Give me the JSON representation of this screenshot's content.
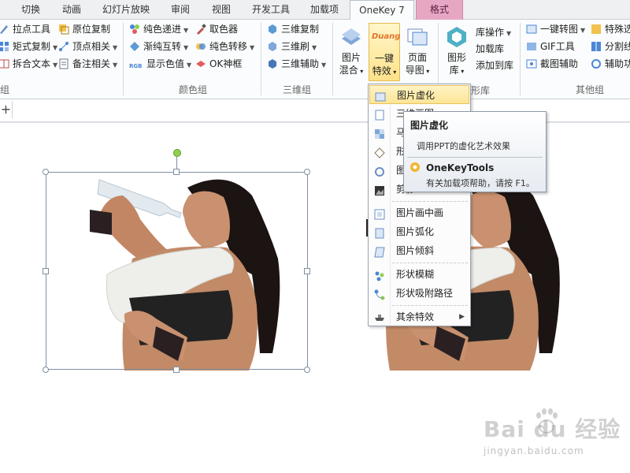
{
  "tabs": [
    {
      "label": "切换",
      "active": false
    },
    {
      "label": "动画",
      "active": false
    },
    {
      "label": "幻灯片放映",
      "active": false
    },
    {
      "label": "审阅",
      "active": false
    },
    {
      "label": "视图",
      "active": false
    },
    {
      "label": "开发工具",
      "active": false
    },
    {
      "label": "加载项",
      "active": false
    },
    {
      "label": "OneKey 7",
      "active": true
    },
    {
      "label": "格式",
      "active": false
    }
  ],
  "ribbon": {
    "group1": {
      "label": "组",
      "items": [
        {
          "label": "拉点工具",
          "icon": "pen-point-icon"
        },
        {
          "label": "矩式复制",
          "icon": "matrix-copy-icon"
        },
        {
          "label": "拆合文本",
          "icon": "split-text-icon"
        },
        {
          "label": "原位复制",
          "icon": "copy-in-place-icon"
        },
        {
          "label": "顶点相关",
          "icon": "vertex-icon"
        },
        {
          "label": "备注相关",
          "icon": "notes-icon"
        }
      ]
    },
    "color_group": {
      "label": "颜色组",
      "items": [
        {
          "label": "纯色递进",
          "icon": "color-progress-icon"
        },
        {
          "label": "渐纯互转",
          "icon": "gradient-convert-icon"
        },
        {
          "label": "显示色值",
          "icon": "rgb-value-icon",
          "prefix": "RGB"
        },
        {
          "label": "取色器",
          "icon": "eyedropper-icon"
        },
        {
          "label": "纯色转移",
          "icon": "color-transfer-icon"
        },
        {
          "label": "OK神框",
          "icon": "ok-frame-icon"
        }
      ]
    },
    "three_d_group": {
      "label": "三维组",
      "items": [
        {
          "label": "三维复制",
          "icon": "3d-copy-icon"
        },
        {
          "label": "三维刷",
          "icon": "3d-brush-icon"
        },
        {
          "label": "三维辅助",
          "icon": "3d-assist-icon"
        }
      ]
    },
    "picture_group": {
      "buttons": [
        {
          "label1": "图片",
          "label2": "混合",
          "icon": "picture-mix-icon"
        },
        {
          "label1": "一键",
          "label2": "特效",
          "icon": "duang-effects-icon",
          "icon_text": "Duang"
        },
        {
          "label1": "页面",
          "label2": "导图",
          "icon": "page-map-icon"
        },
        {
          "label1": "图形",
          "label2": "库",
          "icon": "shape-library-icon"
        }
      ],
      "label_suffix": "形库"
    },
    "library_items": [
      {
        "label": "库操作"
      },
      {
        "label": "加载库"
      },
      {
        "label": "添加到库"
      }
    ],
    "other_group": {
      "label": "其他组",
      "items": [
        {
          "label": "一键转图",
          "icon": "to-image-icon"
        },
        {
          "label": "GIF工具",
          "icon": "gif-icon"
        },
        {
          "label": "截图辅助",
          "icon": "screenshot-icon"
        },
        {
          "label": "特殊选",
          "icon": "special-select-icon"
        },
        {
          "label": "分割线",
          "icon": "divider-icon"
        },
        {
          "label": "辅助功",
          "icon": "assist-icon"
        }
      ]
    }
  },
  "menu": {
    "items": [
      {
        "label": "图片虚化",
        "icon": "blur-picture-icon",
        "highlighted": true
      },
      {
        "label": "三维画图",
        "icon": "3d-draw-icon"
      },
      {
        "label": "马赛克",
        "icon": "mosaic-icon"
      },
      {
        "label": "形状画",
        "icon": "shape-paint-icon"
      },
      {
        "label": "图片旋转",
        "icon": "rotate-picture-icon"
      },
      {
        "label": "剪影",
        "icon": "silhouette-icon"
      },
      {
        "label": "图片画中画",
        "icon": "picture-in-picture-icon"
      },
      {
        "label": "图片弧化",
        "icon": "arc-picture-icon"
      },
      {
        "label": "图片倾斜",
        "icon": "skew-picture-icon"
      },
      {
        "label": "形状模糊",
        "icon": "shape-blur-icon"
      },
      {
        "label": "形状吸附路径",
        "icon": "shape-path-icon"
      },
      {
        "label": "其余特效",
        "icon": "other-effects-icon"
      }
    ]
  },
  "tooltip": {
    "title": "图片虚化",
    "description": "调用PPT的虚化艺术效果",
    "addin_name": "OneKeyTools",
    "help": "有关加载项帮助，请按 F1。"
  },
  "watermark": {
    "brand": "Bai du 经验",
    "url": "jingyan.baidu.com"
  },
  "colors": {
    "tab_format": "#e7a7c4",
    "highlight": "#fde596",
    "selection_border": "#7f8fa3",
    "rotate_handle": "#8fd14f"
  }
}
